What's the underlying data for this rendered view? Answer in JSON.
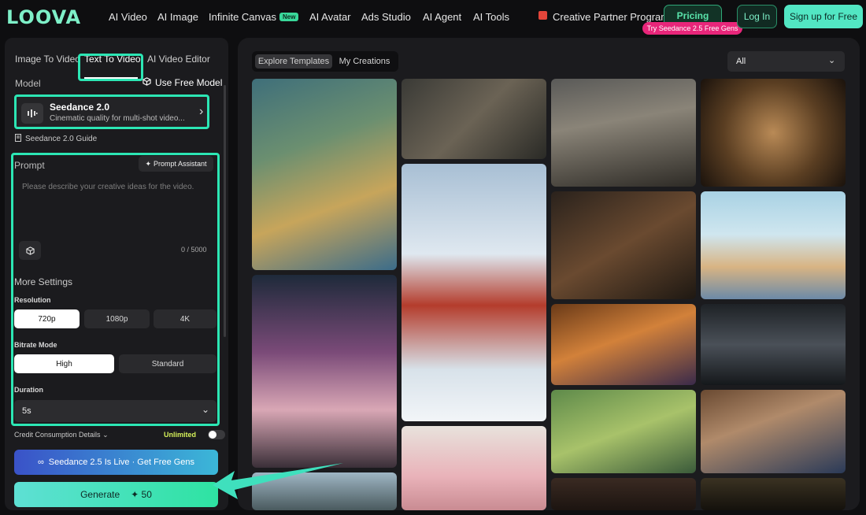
{
  "brand": {
    "logo": "LOOVA"
  },
  "nav": {
    "items": [
      {
        "label": "AI Video"
      },
      {
        "label": "AI Image"
      },
      {
        "label": "Infinite Canvas",
        "badge": "New"
      },
      {
        "label": "AI Avatar"
      },
      {
        "label": "Ads Studio"
      },
      {
        "label": "AI Agent"
      },
      {
        "label": "AI Tools"
      }
    ],
    "partner": "Creative Partner Program",
    "pricing": "Pricing",
    "promo": "Try Seedance 2.5 Free Gens",
    "login": "Log In",
    "signup": "Sign up for Free"
  },
  "left": {
    "tabs": [
      {
        "label": "Image To Video"
      },
      {
        "label": "Text To Video"
      },
      {
        "label": "AI Video Editor"
      }
    ],
    "model_label": "Model",
    "use_free": "Use Free Model",
    "model": {
      "name": "Seedance 2.0",
      "desc": "Cinematic quality for multi-shot video..."
    },
    "guide": "Seedance 2.0 Guide",
    "prompt_label": "Prompt",
    "prompt_assistant": "Prompt Assistant",
    "prompt_placeholder": "Please describe your creative ideas for the video.",
    "counter": "0 / 5000",
    "more_settings": "More Settings",
    "resolution_label": "Resolution",
    "resolutions": [
      "720p",
      "1080p",
      "4K"
    ],
    "bitrate_label": "Bitrate Mode",
    "bitrates": [
      "High",
      "Standard"
    ],
    "duration_label": "Duration",
    "duration_value": "5s",
    "credit_label": "Credit Consumption Details",
    "unlimited": "Unlimited",
    "live_banner": "Seedance 2.5 Is Live · Get Free Gens",
    "generate": "Generate",
    "generate_cost": "50"
  },
  "right": {
    "seg": [
      "Explore Templates",
      "My Creations"
    ],
    "filter": "All"
  },
  "colors": {
    "accent": "#2ce6b4",
    "brand": "#7ef0c8",
    "promo": "#e8267a"
  }
}
